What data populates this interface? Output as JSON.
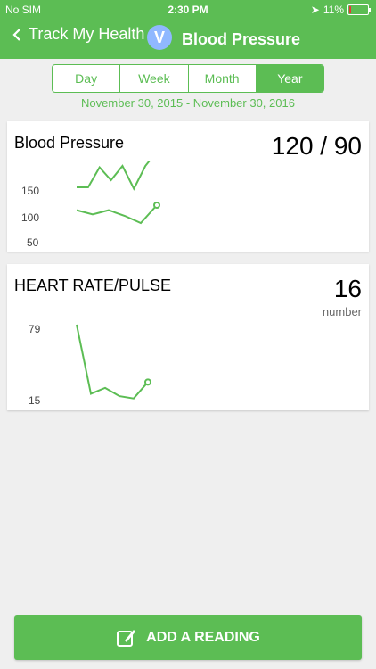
{
  "status_bar": {
    "carrier": "No SIM",
    "time": "2:30 PM",
    "battery": "11%"
  },
  "nav": {
    "back_label": "Track My Health",
    "avatar_letter": "V",
    "title": "Blood Pressure"
  },
  "segments": [
    "Day",
    "Week",
    "Month",
    "Year"
  ],
  "date_range": "November 30, 2015 - November 30, 2016",
  "cards": [
    {
      "title": "Blood Pressure",
      "value": "120 / 90",
      "y_ticks": [
        "150",
        "100",
        "50"
      ],
      "chart_data": {
        "type": "line",
        "series": [
          {
            "values": [
              120,
              120,
              148,
              130,
              150,
              118,
              150,
              170
            ]
          },
          {
            "values": [
              88,
              82,
              88,
              80,
              70,
              95
            ]
          }
        ],
        "ylim": [
          50,
          150
        ]
      }
    },
    {
      "title": "HEART RATE/PULSE",
      "value": "16",
      "unit": "number",
      "y_ticks": [
        "79",
        "15"
      ],
      "chart_data": {
        "type": "line",
        "series": [
          {
            "values": [
              79,
              20,
              25,
              18,
              16,
              30
            ]
          }
        ],
        "ylim": [
          15,
          79
        ]
      }
    }
  ],
  "add_button": {
    "label": "ADD A READING"
  },
  "colors": {
    "accent": "#5cbd54",
    "avatar": "#90b8ff"
  }
}
